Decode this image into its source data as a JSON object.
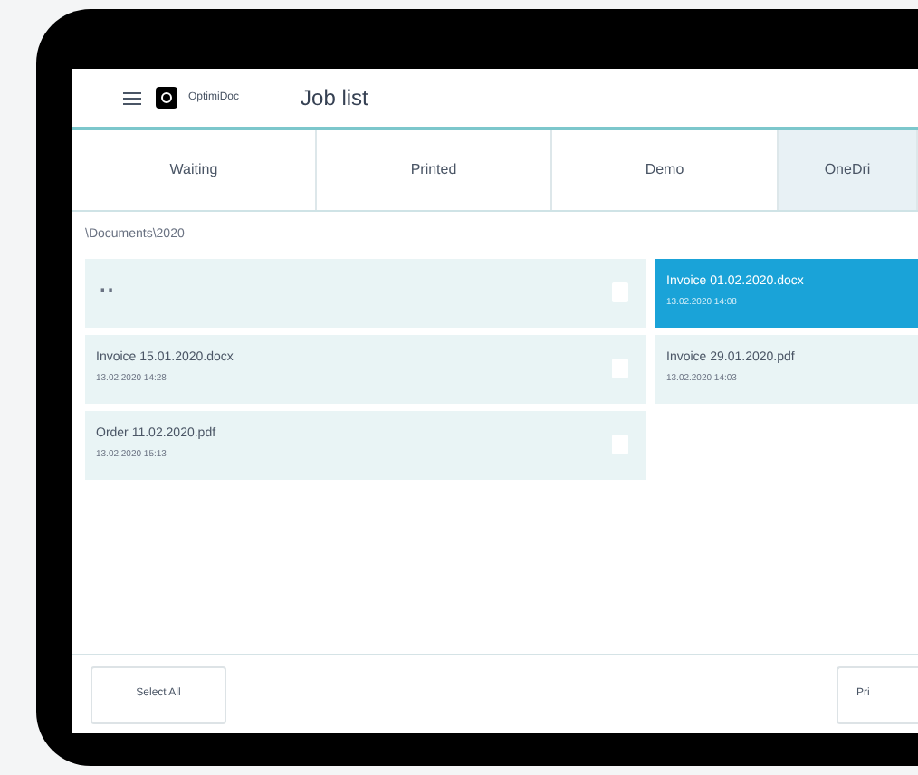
{
  "header": {
    "logo_text": "OptimiDoc",
    "title": "Job list"
  },
  "tabs": [
    {
      "label": "Waiting",
      "selected": false
    },
    {
      "label": "Printed",
      "selected": false
    },
    {
      "label": "Demo",
      "selected": false
    },
    {
      "label": "OneDri",
      "selected": true
    }
  ],
  "path": "\\Documents\\2020",
  "parent_folder": {
    "label": "..",
    "selected": false
  },
  "files": [
    {
      "name": "Invoice 01.02.2020.docx",
      "date": "13.02.2020 14:08",
      "selected": true
    },
    {
      "name": "Invoice 15.01.2020.docx",
      "date": "13.02.2020 14:28",
      "selected": false
    },
    {
      "name": "Invoice 29.01.2020.pdf",
      "date": "13.02.2020 14:03",
      "selected": false
    },
    {
      "name": "Order 11.02.2020.pdf",
      "date": "13.02.2020 15:13",
      "selected": false
    }
  ],
  "buttons": [
    "Select All",
    "Pri"
  ]
}
